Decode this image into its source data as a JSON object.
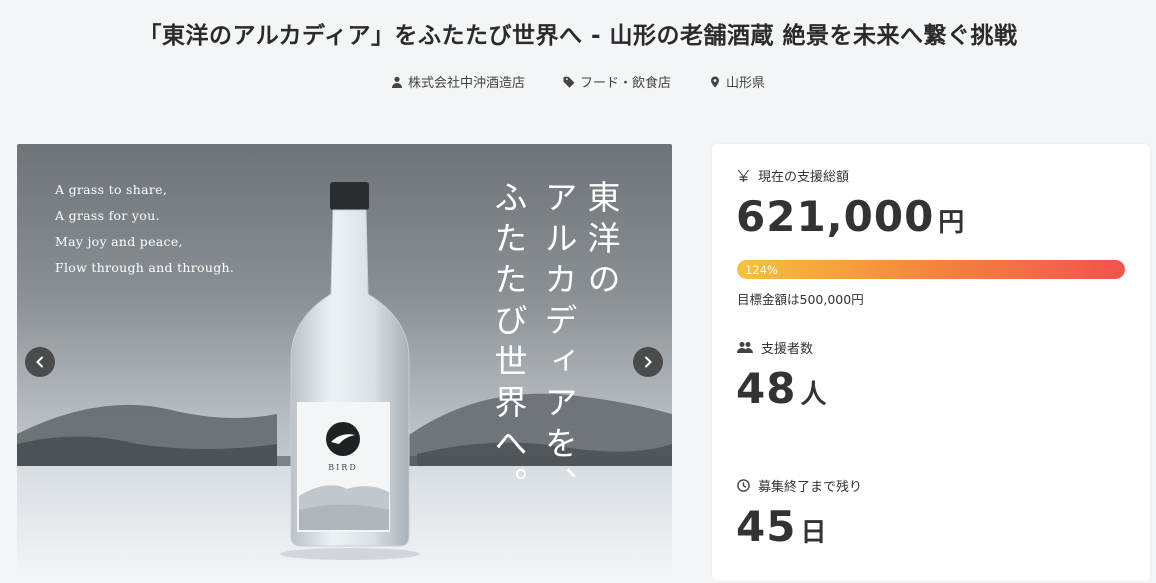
{
  "page": {
    "title": "「東洋のアルカディア」をふたたび世界へ - 山形の老舗酒蔵 絶景を未来へ繋ぐ挑戦"
  },
  "meta": {
    "owner": "株式会社中沖酒造店",
    "category": "フード・飲食店",
    "location": "山形県"
  },
  "hero": {
    "poem": [
      "A grass to share,",
      "A grass for you.",
      "May joy and peace,",
      "Flow through and through."
    ],
    "vertical_lines": [
      "東洋の",
      "アルカディアを、",
      "ふたたび世界へ。"
    ],
    "label_brand": "BIRD"
  },
  "stats": {
    "total_label": "現在の支援総額",
    "total_value": "621,000",
    "total_unit": "円",
    "progress_text": "124%",
    "progress_percent": 124,
    "goal_text": "目標金額は500,000円",
    "supporters_label": "支援者数",
    "supporters_value": "48",
    "supporters_unit": "人",
    "remaining_label": "募集終了まで残り",
    "remaining_value": "45",
    "remaining_unit": "日"
  },
  "colors": {
    "progress_start": "#f7c13b",
    "progress_end": "#f3524d",
    "background": "#f4f5f7"
  }
}
